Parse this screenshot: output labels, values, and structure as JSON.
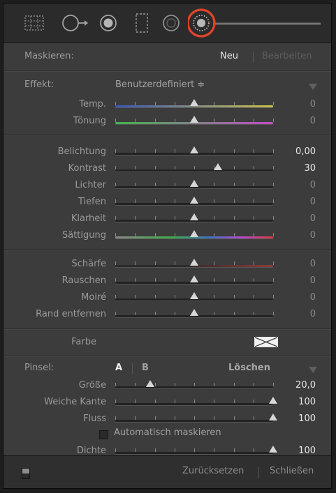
{
  "tools": [
    {
      "name": "crop-overlay-icon",
      "active": false
    },
    {
      "name": "spot-removal-icon",
      "active": false
    },
    {
      "name": "red-eye-icon",
      "active": false
    },
    {
      "name": "graduated-filter-icon",
      "active": false
    },
    {
      "name": "radial-filter-icon",
      "active": false
    },
    {
      "name": "adjustment-brush-icon",
      "active": true
    }
  ],
  "mask": {
    "label": "Maskieren:",
    "new": "Neu",
    "edit": "Bearbeiten"
  },
  "effect": {
    "label": "Effekt:",
    "preset": "Benutzerdefiniert ≑"
  },
  "groups": [
    [
      {
        "label": "Temp.",
        "value": "0",
        "pos": 0.5,
        "gradient": "linear-gradient(90deg,#3a57b8,#c9c24a)"
      },
      {
        "label": "Tönung",
        "value": "0",
        "pos": 0.5,
        "gradient": "linear-gradient(90deg,#3fb64a,#c64bc8)"
      }
    ],
    [
      {
        "label": "Belichtung",
        "value": "0,00",
        "pos": 0.5,
        "bright": true
      },
      {
        "label": "Kontrast",
        "value": "30",
        "pos": 0.65,
        "bright": true
      },
      {
        "label": "Lichter",
        "value": "0",
        "pos": 0.5
      },
      {
        "label": "Tiefen",
        "value": "0",
        "pos": 0.5
      },
      {
        "label": "Klarheit",
        "value": "0",
        "pos": 0.5
      },
      {
        "label": "Sättigung",
        "value": "0",
        "pos": 0.5,
        "gradient": "linear-gradient(90deg,#8a8a8a,#3fae4a 35%,#3f73c0 60%,#b84ad0 80%,#d63a3a)"
      }
    ],
    [
      {
        "label": "Schärfe",
        "value": "0",
        "pos": 0.5,
        "gradient": "linear-gradient(90deg,#2a2a2a 40%,#8c3a3a)"
      },
      {
        "label": "Rauschen",
        "value": "0",
        "pos": 0.5
      },
      {
        "label": "Moiré",
        "value": "0",
        "pos": 0.5
      },
      {
        "label": "Rand entfernen",
        "value": "0",
        "pos": 0.5
      }
    ]
  ],
  "color": {
    "label": "Farbe"
  },
  "brush": {
    "label": "Pinsel:",
    "a": "A",
    "b": "B",
    "erase": "Löschen",
    "sliders": [
      {
        "label": "Größe",
        "value": "20,0",
        "pos": 0.22,
        "bright": true
      },
      {
        "label": "Weiche Kante",
        "value": "100",
        "pos": 1,
        "bright": true
      },
      {
        "label": "Fluss",
        "value": "100",
        "pos": 1,
        "bright": true
      }
    ],
    "automask": "Automatisch maskieren",
    "density": {
      "label": "Dichte",
      "value": "100",
      "pos": 1,
      "bright": true
    }
  },
  "footer": {
    "reset": "Zurücksetzen",
    "close": "Schließen"
  },
  "accent": "#e0452a"
}
